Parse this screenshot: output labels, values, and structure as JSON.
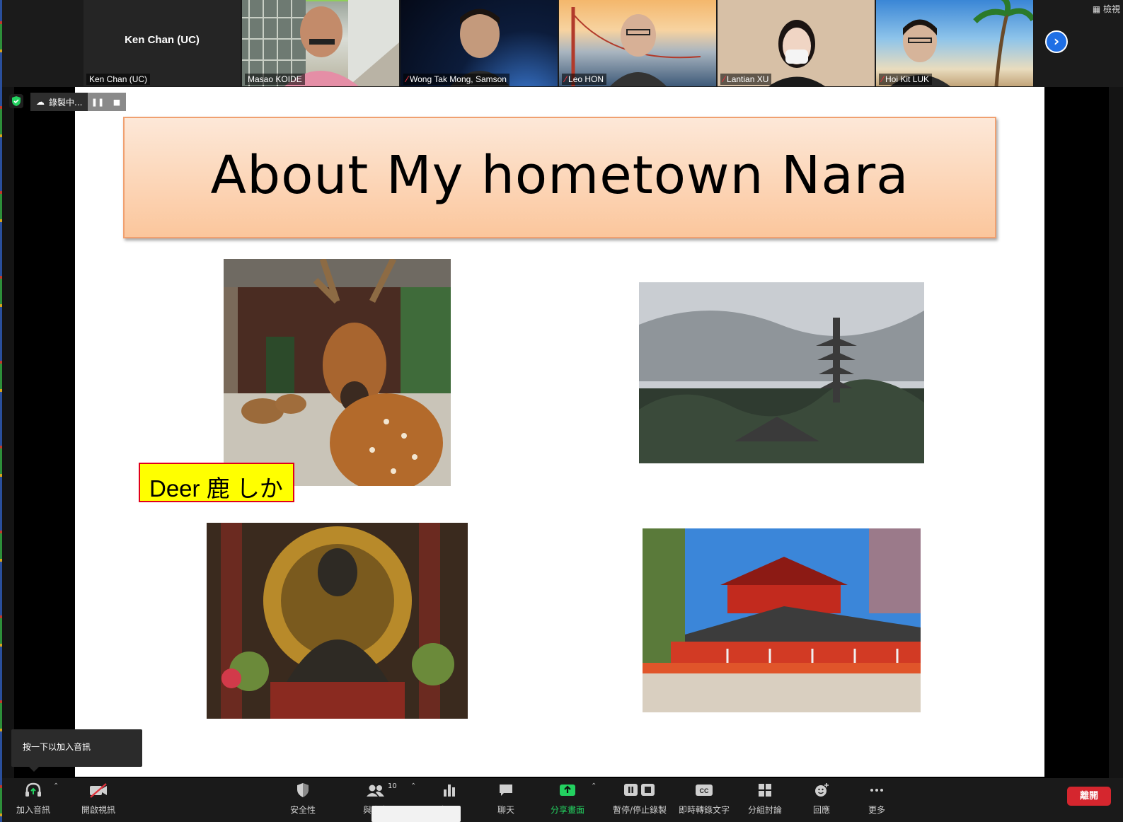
{
  "participants": [
    {
      "name": "Ken Chan (UC)",
      "display_name": "Ken Chan (UC)",
      "muted": false
    },
    {
      "name": "Masao KOIDE",
      "muted": false,
      "active_speaker": true
    },
    {
      "name": "Wong Tak Mong, Samson",
      "muted": true
    },
    {
      "name": "Leo HON",
      "muted": true
    },
    {
      "name": "Lantian XU",
      "muted": true
    },
    {
      "name": "Hoi Kit LUK",
      "muted": true
    }
  ],
  "view_button": "檢視",
  "recording": {
    "label": "錄製中..."
  },
  "slide": {
    "title": "About My hometown Nara",
    "deer_label": "Deer 鹿 しか"
  },
  "tooltip": "按一下以加入音訊",
  "toolbar": {
    "join_audio": "加入音訊",
    "start_video": "開啟視訊",
    "security": "安全性",
    "participants": "與會者",
    "participants_count": "10",
    "polls": "投票",
    "chat": "聊天",
    "share_screen": "分享畫面",
    "pause_stop_recording": "暫停/停止錄製",
    "live_transcript": "即時轉錄文字",
    "breakout_rooms": "分組討論",
    "reactions": "回應",
    "more": "更多",
    "leave": "離開"
  },
  "colors": {
    "accent_blue": "#1f6fe5",
    "end_red": "#d5262e",
    "share_green": "#23d160",
    "title_box": "#fbc69c",
    "label_yellow": "#ffff00"
  }
}
